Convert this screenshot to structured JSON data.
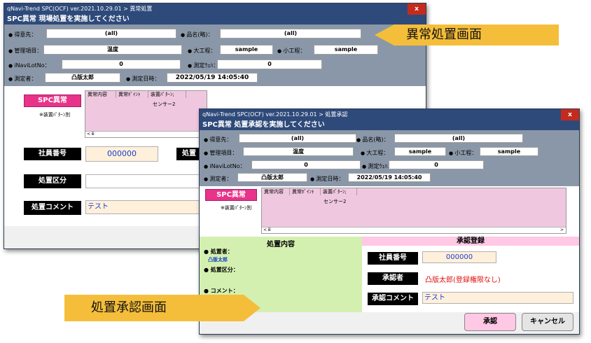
{
  "w1": {
    "title": "qNavi-Trend SPC(OCF) ver.2021.10.29.01 > 異常処置",
    "close": "x",
    "header": "SPC異常 現場処置を実施してください",
    "labels": {
      "customer": "得意先：",
      "product": "品名(略)：",
      "item": "管理項目：",
      "process": "大工程：",
      "subprocess": "小工程：",
      "lot": "iNaviLotNo：",
      "wafer": "測定ｳｪﾊ：",
      "measurer": "測定者：",
      "date": "測定日時："
    },
    "values": {
      "customer": "(all)",
      "product": "(all)",
      "item": "温度",
      "process": "sample",
      "subprocess": "sample",
      "lot": "0",
      "wafer": "0",
      "measurer": "凸版太郎",
      "date": "2022/05/19 14:05:40"
    },
    "spc_button": "SPC異常",
    "note": "※装置ﾊﾟﾀｰﾝ別",
    "grid_cols": [
      "異常内容",
      "異常ﾎﾟｲﾝﾄ",
      "装置ﾊﾟﾀｰﾝ;"
    ],
    "grid_cell": "センサー2",
    "scroll_mark": "< ⅲ",
    "emp_label": "社員番号",
    "emp_value": "000000",
    "action_label_partial": "処置",
    "category_label": "処置区分",
    "comment_label": "処置コメント",
    "comment_value": "テスト"
  },
  "w2": {
    "title": "qNavi-Trend SPC(OCF) ver.2021.10.29.01 > 処置承認",
    "close": "x",
    "header": "SPC異常 処置承認を実施してください",
    "labels": {
      "customer": "得意先：",
      "product": "品名(略)：",
      "item": "管理項目：",
      "process": "大工程：",
      "subprocess": "小工程：",
      "lot": "iNaviLotNo：",
      "wafer": "測定ｳｪﾊ：",
      "measurer": "測定者：",
      "date": "測定日時："
    },
    "values": {
      "customer": "(all)",
      "product": "(all)",
      "item": "温度",
      "process": "sample",
      "subprocess": "sample",
      "lot": "0",
      "wafer": "0",
      "measurer": "凸版太郎",
      "date": "2022/05/19 14:05:40"
    },
    "spc_button": "SPC異常",
    "note": "※装置ﾊﾟﾀｰﾝ別",
    "grid_cols": [
      "異常内容",
      "異常ﾎﾟｲﾝﾄ",
      "装置ﾊﾟﾀｰﾝ;"
    ],
    "grid_cell": "センサー2",
    "scroll_left": "< ⅲ",
    "scroll_right": ">",
    "left_header": "処置内容",
    "right_header": "承認登録",
    "treater_label": "● 処置者：",
    "treater_value": "凸版太郎",
    "category_label": "● 処置区分：",
    "comment_label": "● コメント：",
    "emp_label": "社員番号",
    "emp_value": "000000",
    "approver_label": "承認者",
    "approver_value": "凸版太郎(登録権限なし)",
    "approval_comment_label": "承認コメント",
    "approval_comment_value": "テスト",
    "approve_button": "承認",
    "cancel_button": "キャンセル"
  },
  "callouts": {
    "top": "異常処置画面",
    "bottom": "処置承認画面"
  },
  "colors": {
    "titlebar": "#2e4a7a",
    "info_panel": "#8a97a8",
    "pink_button": "#e8338a",
    "grid_bg": "#efc8e0",
    "callout": "#f5be3a",
    "left_panel": "#d4f0b0",
    "right_header": "#ffc8e4",
    "input_bg": "#fff0dc",
    "id_blue": "#1a3cc8",
    "error_red": "#e01010"
  }
}
